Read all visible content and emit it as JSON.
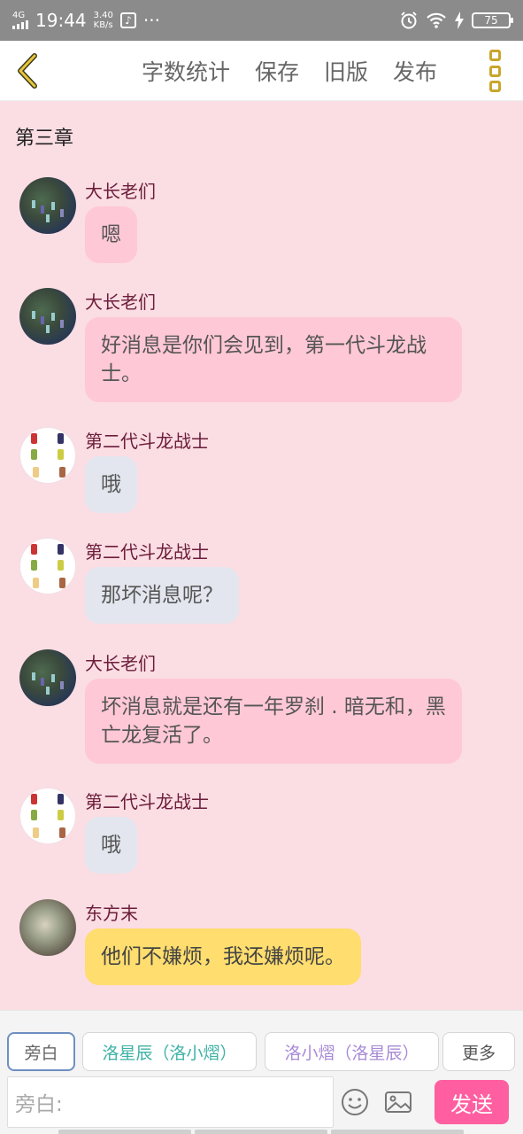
{
  "status_bar": {
    "network": "4G",
    "time": "19:44",
    "speed_value": "3.40",
    "speed_unit": "KB/s",
    "more": "···",
    "battery": "75"
  },
  "toolbar": {
    "items": [
      "字数统计",
      "保存",
      "旧版",
      "发布"
    ]
  },
  "chapter_title": "第三章",
  "messages": [
    {
      "sender": "大长老们",
      "text": "嗯",
      "style": "pink",
      "avatar": "dark-scene"
    },
    {
      "sender": "大长老们",
      "text": "好消息是你们会见到，第一代斗龙战士。",
      "style": "pink",
      "avatar": "dark-scene"
    },
    {
      "sender": "第二代斗龙战士",
      "text": "哦",
      "style": "gray",
      "avatar": "sprites"
    },
    {
      "sender": "第二代斗龙战士",
      "text": "那坏消息呢？",
      "style": "gray",
      "avatar": "sprites"
    },
    {
      "sender": "大长老们",
      "text": "坏消息就是还有一年罗刹 . 暗无和，黑亡龙复活了。",
      "style": "pink",
      "avatar": "dark-scene"
    },
    {
      "sender": "第二代斗龙战士",
      "text": "哦",
      "style": "gray",
      "avatar": "sprites"
    },
    {
      "sender": "东方末",
      "text": "他们不嫌烦，我还嫌烦呢。",
      "style": "yellow",
      "avatar": "photo"
    }
  ],
  "roles": {
    "narrator": "旁白",
    "role1": "洛星辰（洛小熠）",
    "role2": "洛小熠（洛星辰）",
    "more": "更多"
  },
  "input": {
    "placeholder": "旁白:"
  },
  "send_label": "发送",
  "colors": {
    "accent": "#ff5fa0",
    "background": "#fbdde4",
    "sender_name": "#6b1d3a"
  }
}
